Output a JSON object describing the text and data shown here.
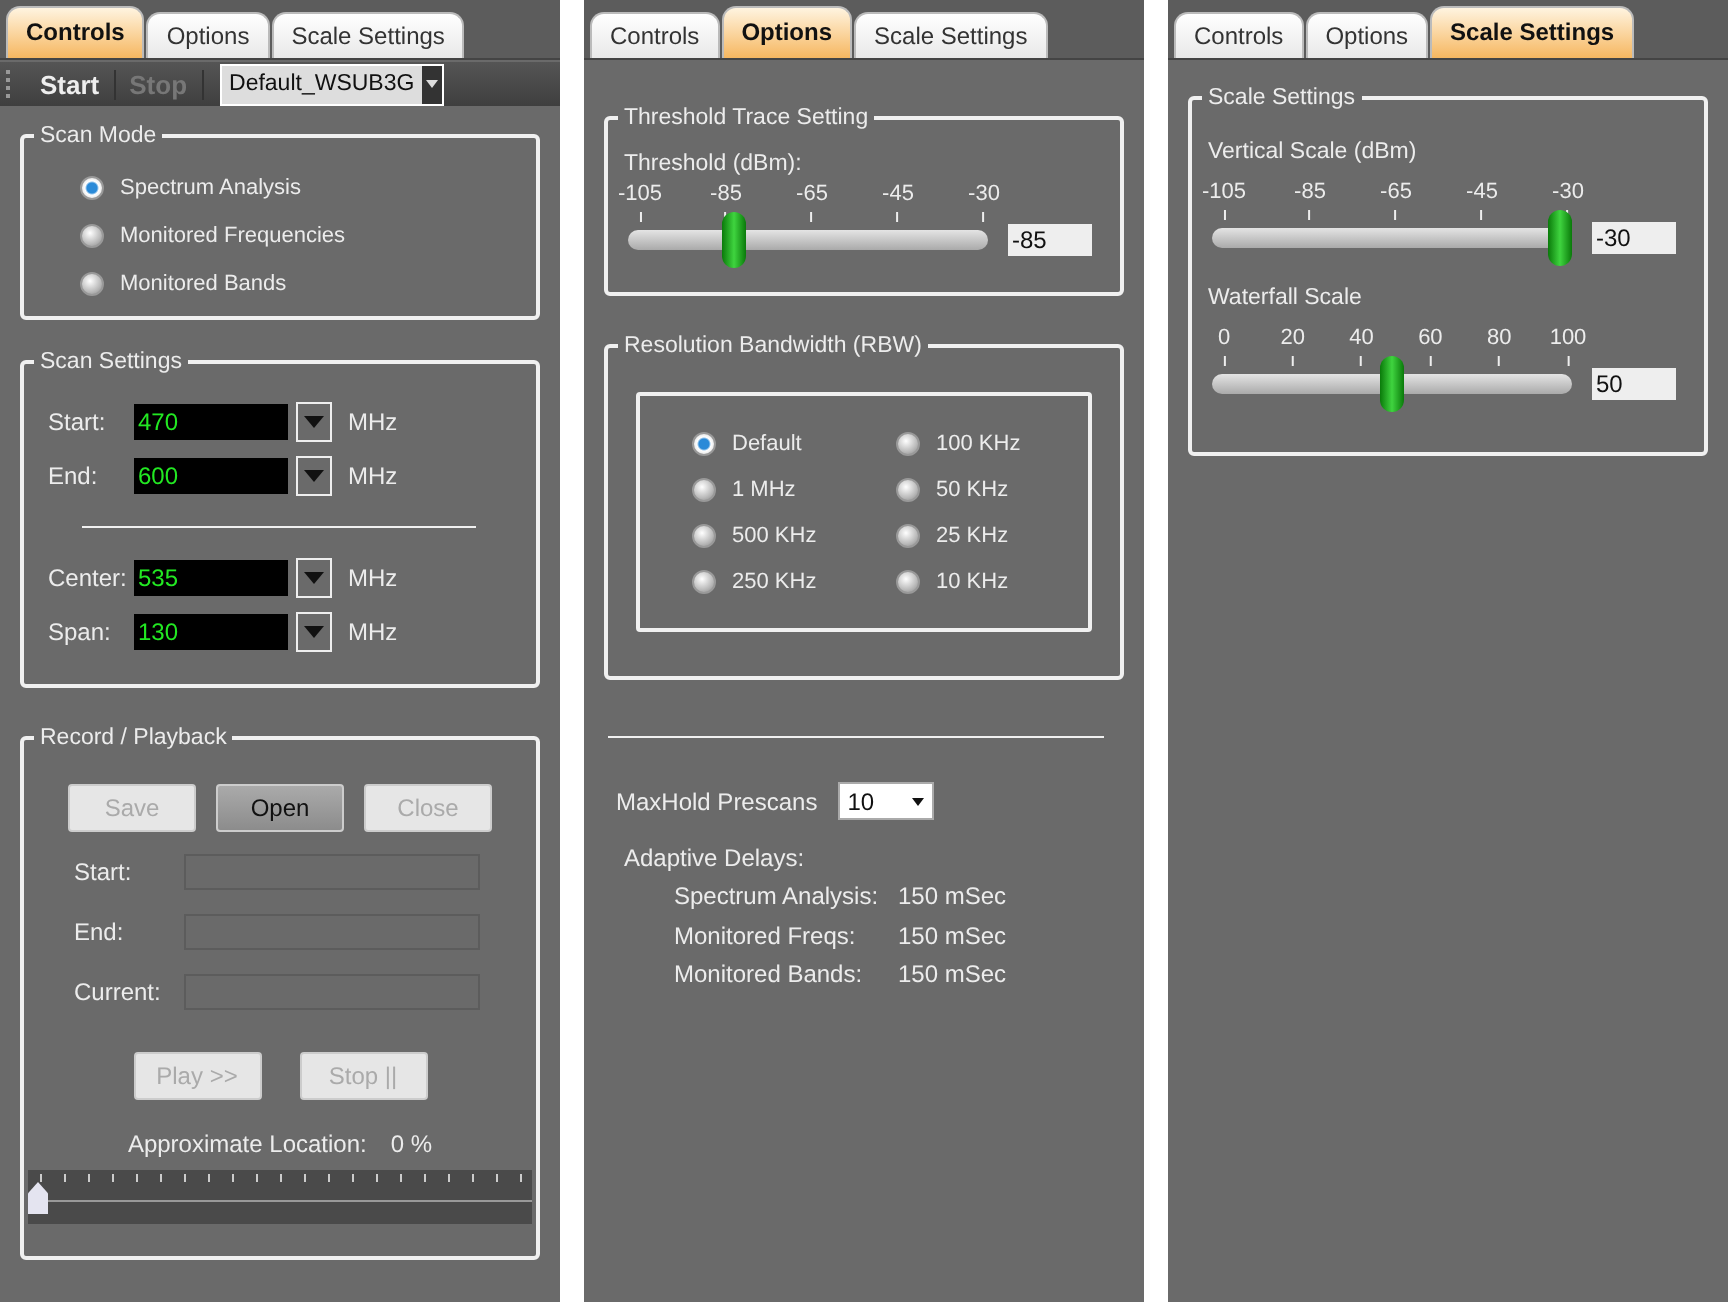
{
  "controls_panel": {
    "tabs": [
      {
        "label": "Controls",
        "selected": true
      },
      {
        "label": "Options",
        "selected": false
      },
      {
        "label": "Scale Settings",
        "selected": false
      }
    ],
    "toolbar": {
      "buttons": [
        {
          "label": "Start",
          "disabled": false
        },
        {
          "label": "Stop",
          "disabled": true
        }
      ],
      "profile": "Default_WSUB3G"
    },
    "scan_mode": {
      "title": "Scan Mode",
      "options": [
        {
          "label": "Spectrum Analysis",
          "selected": true
        },
        {
          "label": "Monitored Frequencies",
          "selected": false
        },
        {
          "label": "Monitored Bands",
          "selected": false
        }
      ]
    },
    "scan_settings": {
      "title": "Scan Settings",
      "range_fields": [
        {
          "label": "Start:",
          "value": "470",
          "unit": "MHz"
        },
        {
          "label": "End:",
          "value": "600",
          "unit": "MHz"
        }
      ],
      "center_fields": [
        {
          "label": "Center:",
          "value": "535",
          "unit": "MHz"
        },
        {
          "label": "Span:",
          "value": "130",
          "unit": "MHz"
        }
      ]
    },
    "record_playback": {
      "title": "Record / Playback",
      "file_buttons": [
        {
          "label": "Save",
          "disabled": true
        },
        {
          "label": "Open",
          "disabled": false
        },
        {
          "label": "Close",
          "disabled": true
        }
      ],
      "fields": [
        {
          "label": "Start:"
        },
        {
          "label": "End:"
        },
        {
          "label": "Current:"
        }
      ],
      "play_buttons": [
        {
          "label": "Play >>",
          "disabled": true
        },
        {
          "label": "Stop ||",
          "disabled": true
        }
      ],
      "location_label": "Approximate Location:",
      "location_value": "0 %",
      "location": {
        "level": 0
      }
    }
  },
  "options_panel": {
    "tabs": [
      {
        "label": "Controls",
        "selected": false
      },
      {
        "label": "Options",
        "selected": true
      },
      {
        "label": "Scale Settings",
        "selected": false
      }
    ],
    "threshold": {
      "title": "Threshold Trace Setting",
      "label": "Threshold (dBm):",
      "ticks": [
        "-105",
        "-85",
        "-65",
        "-45",
        "-30"
      ],
      "level": 0.28,
      "value": "-85"
    },
    "rbw": {
      "title": "Resolution Bandwidth (RBW)",
      "options": [
        {
          "label": "Default",
          "selected": true
        },
        {
          "label": "100 KHz",
          "selected": false
        },
        {
          "label": "1 MHz",
          "selected": false
        },
        {
          "label": "50 KHz",
          "selected": false
        },
        {
          "label": "500 KHz",
          "selected": false
        },
        {
          "label": "25 KHz",
          "selected": false
        },
        {
          "label": "250 KHz",
          "selected": false
        },
        {
          "label": "10 KHz",
          "selected": false
        }
      ]
    },
    "maxhold": {
      "label": "MaxHold Prescans",
      "value": "10"
    },
    "delays": {
      "title": "Adaptive Delays:",
      "rows": [
        {
          "label": "Spectrum Analysis:",
          "value": "150 mSec"
        },
        {
          "label": "Monitored Freqs:",
          "value": "150 mSec"
        },
        {
          "label": "Monitored Bands:",
          "value": "150 mSec"
        }
      ]
    }
  },
  "scale_panel": {
    "tabs": [
      {
        "label": "Controls",
        "selected": false
      },
      {
        "label": "Options",
        "selected": false
      },
      {
        "label": "Scale Settings",
        "selected": true
      }
    ],
    "title": "Scale Settings",
    "sliders": [
      {
        "label": "Vertical Scale (dBm)",
        "ticks": [
          "-105",
          "-85",
          "-65",
          "-45",
          "-30"
        ],
        "level": 1,
        "value": "-30"
      },
      {
        "label": "Waterfall Scale",
        "ticks": [
          "0",
          "20",
          "40",
          "60",
          "80",
          "100"
        ],
        "level": 0.5,
        "value": "50"
      }
    ]
  }
}
